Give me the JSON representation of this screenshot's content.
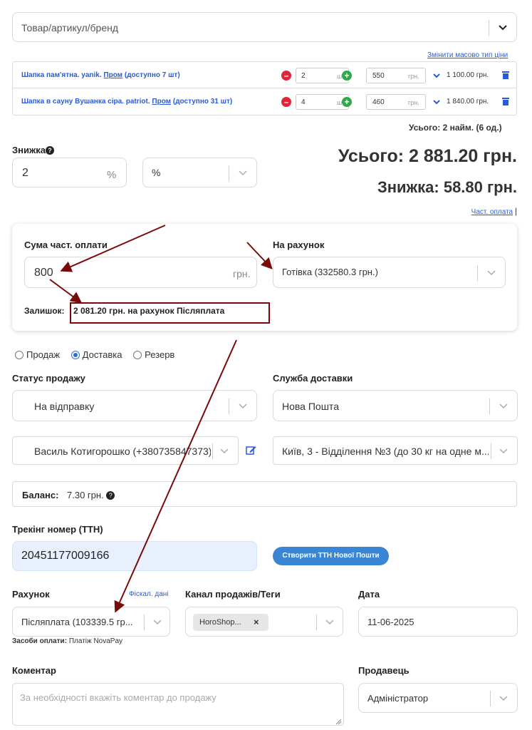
{
  "search": {
    "placeholder": "Товар/артикул/бренд"
  },
  "mass_price_link": "Змінити масово тип ціни",
  "items": [
    {
      "name": "Шапка пам'ятна. yanik.",
      "source": "Пром",
      "avail": "(доступно 7 шт)",
      "qty": "2",
      "unit": "шт",
      "price": "550",
      "currency": "грн.",
      "total": "1 100.00 грн."
    },
    {
      "name": "Шапка в сауну Вушанка сіра. patriot.",
      "source": "Пром",
      "avail": "(доступно 31 шт)",
      "qty": "4",
      "unit": "шт",
      "price": "460",
      "currency": "грн.",
      "total": "1 840.00 грн."
    }
  ],
  "summary_count": "Усього: 2 найм. (6 од.)",
  "discount": {
    "label": "Знижка",
    "value": "2",
    "unit": "%",
    "type": "%"
  },
  "totals": {
    "total": "Усього: 2 881.20 грн.",
    "discount": "Знижка: 58.80 грн.",
    "partial_link": "Част. оплата",
    "sep": "|"
  },
  "partial": {
    "sum_label": "Сума част. оплати",
    "sum_value": "800",
    "sum_unit": "грн.",
    "account_label": "На рахунок",
    "account_value": "Готівка (332580.3 грн.)",
    "remainder_label": "Залишок:",
    "remainder_value": "2 081.20 грн. на рахунок Післяплата"
  },
  "order_type": {
    "options": [
      "Продаж",
      "Доставка",
      "Резерв"
    ],
    "selected": 1
  },
  "status": {
    "label": "Статус продажу",
    "value": "На відправку"
  },
  "delivery": {
    "label": "Служба доставки",
    "value": "Нова Пошта"
  },
  "customer": {
    "value": "Василь Котигорошко (+380735847373)"
  },
  "branch": {
    "value": "Київ, 3 - Відділення №3 (до 30 кг на одне м..."
  },
  "balance": {
    "label": "Баланс:",
    "value": "7.30 грн."
  },
  "tracking": {
    "label": "Трекінг номер (ТТН)",
    "value": "20451177009166",
    "button": "Створити ТТН Нової Пошти"
  },
  "account": {
    "label": "Рахунок",
    "fiscal_link": "Фіскал. дані",
    "value": "Післяплата (103339.5 гр...",
    "payment_means_label": "Засоби оплати:",
    "payment_means_value": "Платіж NovaPay"
  },
  "channel": {
    "label": "Канал продажів/Теги",
    "tag": "HoroShop..."
  },
  "date": {
    "label": "Дата",
    "value": "11-06-2025"
  },
  "comment": {
    "label": "Коментар",
    "placeholder": "За необхідності вкажіть коментар до продажу"
  },
  "seller": {
    "label": "Продавець",
    "value": "Адміністратор"
  },
  "colors": {
    "annotation": "#7a0a0a",
    "primary": "#3a86d4",
    "danger": "#e0243a",
    "success": "#2eaa4a"
  }
}
